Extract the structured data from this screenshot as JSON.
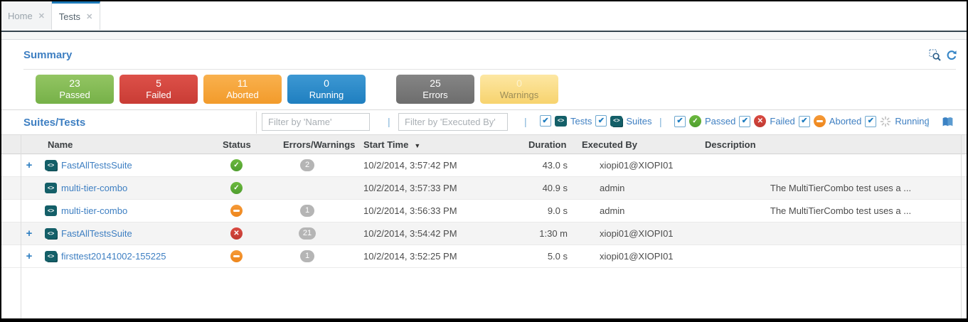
{
  "ui": {
    "close_glyph": "✕",
    "check_glyph": "✔",
    "code_glyph": "<>",
    "expand_glyph": "+",
    "sort_desc_glyph": "▼",
    "separator": "|",
    "passed_glyph": "✓",
    "failed_glyph": "✕",
    "accent_color": "#1c79b8",
    "link_color": "#3e7fc2"
  },
  "tabs": [
    {
      "label": "Home",
      "active": false
    },
    {
      "label": "Tests",
      "active": true
    }
  ],
  "summary": {
    "title": "Summary",
    "cards": [
      {
        "value": "23",
        "label": "Passed",
        "color": "#84bd51"
      },
      {
        "value": "5",
        "label": "Failed",
        "color": "#d2443d"
      },
      {
        "value": "11",
        "label": "Aborted",
        "color": "#f5a63c"
      },
      {
        "value": "0",
        "label": "Running",
        "color": "#2b8bca"
      },
      {
        "value": "25",
        "label": "Errors",
        "color": "#787878"
      },
      {
        "value": "0",
        "label": "Warnings",
        "color": "#fbdd8a"
      }
    ]
  },
  "filters": {
    "title": "Suites/Tests",
    "name_placeholder": "Filter by 'Name'",
    "executed_by_placeholder": "Filter by 'Executed By'",
    "type_toggles": [
      {
        "label": "Tests",
        "checked": true
      },
      {
        "label": "Suites",
        "checked": true
      }
    ],
    "status_toggles": [
      {
        "label": "Passed",
        "checked": true
      },
      {
        "label": "Failed",
        "checked": true
      },
      {
        "label": "Aborted",
        "checked": true
      },
      {
        "label": "Running",
        "checked": true
      }
    ]
  },
  "table": {
    "columns": [
      "Name",
      "Status",
      "Errors/Warnings",
      "Start Time",
      "Duration",
      "Executed By",
      "Description"
    ],
    "sort": {
      "column": "Start Time",
      "direction": "desc"
    },
    "rows": [
      {
        "expandable": true,
        "kind": "suite",
        "name": "FastAllTestsSuite",
        "status": "passed",
        "errors_warnings": "2",
        "start_time": "10/2/2014, 3:57:42 PM",
        "duration": "43.0 s",
        "executed_by": "xiopi01@XIOPI01",
        "description": ""
      },
      {
        "expandable": false,
        "kind": "test",
        "name": "multi-tier-combo",
        "status": "passed",
        "errors_warnings": "",
        "start_time": "10/2/2014, 3:57:33 PM",
        "duration": "40.9 s",
        "executed_by": "admin",
        "description": "The MultiTierCombo test uses a ..."
      },
      {
        "expandable": false,
        "kind": "test",
        "name": "multi-tier-combo",
        "status": "aborted",
        "errors_warnings": "1",
        "start_time": "10/2/2014, 3:56:33 PM",
        "duration": "9.0 s",
        "executed_by": "admin",
        "description": "The MultiTierCombo test uses a ..."
      },
      {
        "expandable": true,
        "kind": "suite",
        "name": "FastAllTestsSuite",
        "status": "failed",
        "errors_warnings": "21",
        "start_time": "10/2/2014, 3:54:42 PM",
        "duration": "1:30 m",
        "executed_by": "xiopi01@XIOPI01",
        "description": ""
      },
      {
        "expandable": true,
        "kind": "suite",
        "name": "firsttest20141002-155225",
        "status": "aborted",
        "errors_warnings": "1",
        "start_time": "10/2/2014, 3:52:25 PM",
        "duration": "5.0 s",
        "executed_by": "xiopi01@XIOPI01",
        "description": ""
      }
    ]
  }
}
